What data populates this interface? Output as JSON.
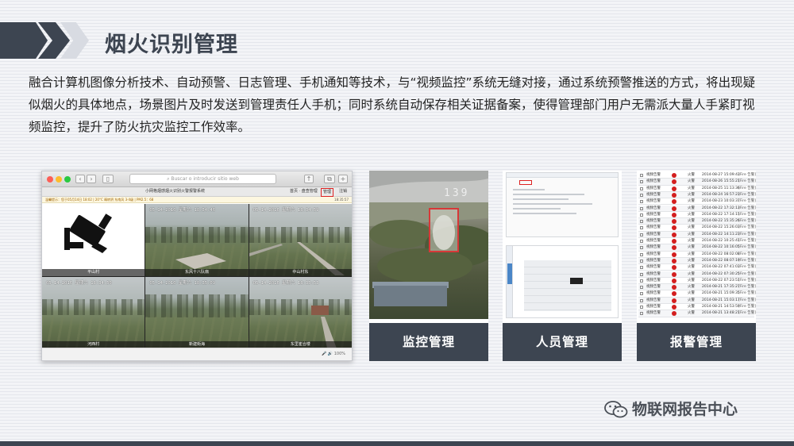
{
  "header": {
    "title": "烟火识别管理"
  },
  "description": "融合计算机图像分析技术、自动预警、日志管理、手机通知等技术，与“视频监控”系统无缝对接，通过系统预警推送的方式，将出现疑似烟火的具体地点，场景图片及时发送到管理责任人手机；同时系统自动保存相关证据备案，使得管理部门用户无需派大量人手紧盯视频监控，提升了防火抗灾监控工作效率。",
  "screenshot": {
    "url_placeholder": "Buscar o introducir sitio web",
    "app_title": "小网格烟感烟火识别火警报警系统",
    "menu_a": "首页 · 盘查管理",
    "menu_b": "管理",
    "menu_c": "注销",
    "notice": "温馨提示：您于05月14日 18:02 | 20°C 晴转阴 东南风 3-4级 | PM2.5：68",
    "notice_time": "18:35:57",
    "status_zoom": "100%",
    "cells": [
      {
        "label": "平山村",
        "osd": "",
        "icon": "cctv-camera-icon"
      },
      {
        "label": "东风十八队扇",
        "osd": "05-14-2016 星期六 18:34:46",
        "icon": ""
      },
      {
        "label": "中山村东",
        "osd": "05-14-2016 星期六 18:34:59",
        "icon": ""
      },
      {
        "label": "河西村",
        "osd": "05-14-2016 星期六 18:34:50",
        "icon": ""
      },
      {
        "label": "新建街海",
        "osd": "05-14-2016 星期六 18:35:09",
        "icon": ""
      },
      {
        "label": "东里崔合楼",
        "osd": "05-14-2016 星期六 18:35:53",
        "icon": ""
      }
    ]
  },
  "cards": [
    {
      "label": "监控管理",
      "overlay_number": "139"
    },
    {
      "label": "人员管理"
    },
    {
      "label": "报警管理"
    }
  ],
  "alarm_list": [
    {
      "type": "视频告警",
      "kind": "火警",
      "time": "2014-08-27 15:09:43",
      "state": "[Fire 告警]"
    },
    {
      "type": "视频告警",
      "kind": "火警",
      "time": "2014-08-26 15:55:21",
      "state": "[Fire 告警]"
    },
    {
      "type": "视频告警",
      "kind": "火警",
      "time": "2014-08-25 11:13:36",
      "state": "[Fire 告警]"
    },
    {
      "type": "视频告警",
      "kind": "火警",
      "time": "2014-08-24 16:57:23",
      "state": "[Fire 告警]"
    },
    {
      "type": "视频告警",
      "kind": "火警",
      "time": "2014-08-23 10:03:37",
      "state": "[Fire 告警]"
    },
    {
      "type": "视频告警",
      "kind": "火警",
      "time": "2014-08-22 17:32:13",
      "state": "[Fire 告警]"
    },
    {
      "type": "视频告警",
      "kind": "火警",
      "time": "2014-08-22 17:14:15",
      "state": "[Fire 告警]"
    },
    {
      "type": "视频告警",
      "kind": "火警",
      "time": "2014-08-22 15:35:26",
      "state": "[Fire 告警]"
    },
    {
      "type": "视频告警",
      "kind": "火警",
      "time": "2014-08-22 15:26:03",
      "state": "[Fire 告警]"
    },
    {
      "type": "视频告警",
      "kind": "火警",
      "time": "2014-08-22 14:11:23",
      "state": "[Fire 告警]"
    },
    {
      "type": "视频告警",
      "kind": "火警",
      "time": "2014-08-22 10:25:41",
      "state": "[Fire 告警]"
    },
    {
      "type": "视频告警",
      "kind": "火警",
      "time": "2014-08-22 10:16:05",
      "state": "[Fire 告警]"
    },
    {
      "type": "视频告警",
      "kind": "火警",
      "time": "2014-08-22 08:02:08",
      "state": "[Fire 告警]"
    },
    {
      "type": "视频告警",
      "kind": "火警",
      "time": "2014-08-22 08:07:19",
      "state": "[Fire 告警]"
    },
    {
      "type": "视频告警",
      "kind": "火警",
      "time": "2014-08-22 07:41:03",
      "state": "[Fire 告警]"
    },
    {
      "type": "视频告警",
      "kind": "火警",
      "time": "2014-08-22 07:30:25",
      "state": "[Fire 告警]"
    },
    {
      "type": "视频告警",
      "kind": "火警",
      "time": "2014-08-22 07:23:51",
      "state": "[Fire 告警]"
    },
    {
      "type": "视频告警",
      "kind": "火警",
      "time": "2014-08-21 17:35:27",
      "state": "[Fire 告警]"
    },
    {
      "type": "视频告警",
      "kind": "火警",
      "time": "2014-08-21 15:09:35",
      "state": "[Fire 告警]"
    },
    {
      "type": "视频告警",
      "kind": "火警",
      "time": "2014-08-21 15:03:17",
      "state": "[Fire 告警]"
    },
    {
      "type": "视频告警",
      "kind": "火警",
      "time": "2014-08-21 14:53:59",
      "state": "[Fire 告警]"
    },
    {
      "type": "视频告警",
      "kind": "火警",
      "time": "2014-08-21 13:48:21",
      "state": "[Fire 告警]"
    }
  ],
  "watermark": {
    "text": "物联网报告中心",
    "icon": "wechat-icon"
  },
  "colors": {
    "brand": "#3d4551",
    "alert": "#d31f1f"
  }
}
